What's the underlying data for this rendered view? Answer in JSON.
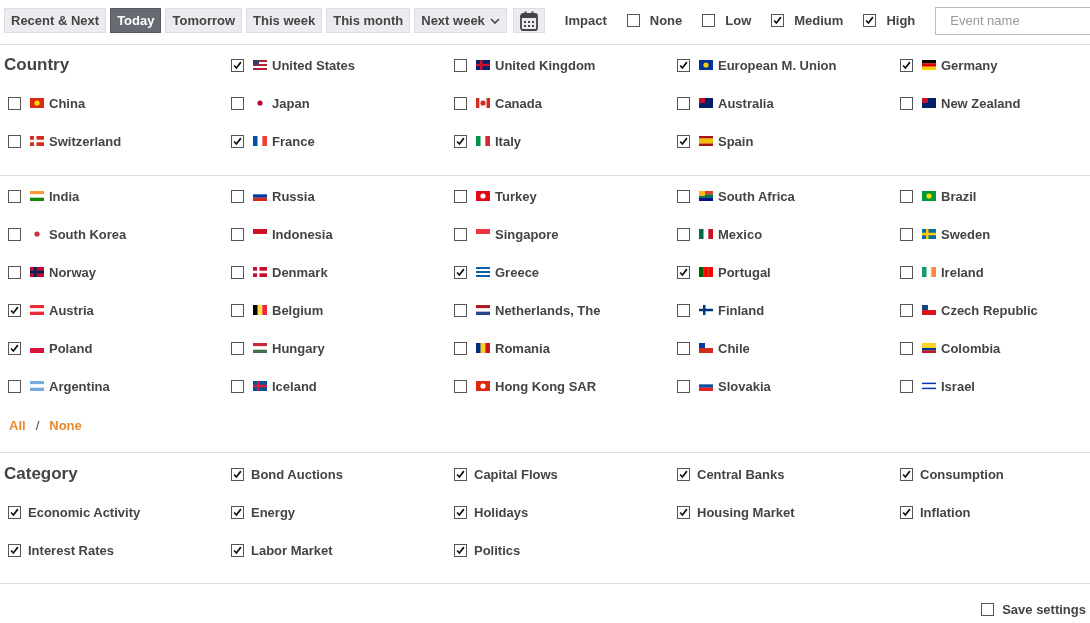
{
  "toolbar": {
    "period_tabs": [
      {
        "label": "Recent & Next",
        "selected": false,
        "kind": "plain"
      },
      {
        "label": "Today",
        "selected": true,
        "kind": "plain"
      },
      {
        "label": "Tomorrow",
        "selected": false,
        "kind": "plain"
      },
      {
        "label": "This week",
        "selected": false,
        "kind": "plain"
      },
      {
        "label": "This month",
        "selected": false,
        "kind": "plain"
      },
      {
        "label": "Next week",
        "selected": false,
        "kind": "dropdown"
      }
    ],
    "impact": {
      "label": "Impact",
      "options": [
        {
          "label": "None",
          "checked": false
        },
        {
          "label": "Low",
          "checked": false
        },
        {
          "label": "Medium",
          "checked": true
        },
        {
          "label": "High",
          "checked": true
        }
      ]
    },
    "search": {
      "placeholder": "Event name"
    }
  },
  "country": {
    "title": "Country",
    "groups": [
      [
        {
          "name": "United States",
          "checked": true
        },
        {
          "name": "United Kingdom",
          "checked": false
        },
        {
          "name": "European M. Union",
          "checked": true
        },
        {
          "name": "Germany",
          "checked": true
        },
        {
          "name": "China",
          "checked": false
        },
        {
          "name": "Japan",
          "checked": false
        },
        {
          "name": "Canada",
          "checked": false
        },
        {
          "name": "Australia",
          "checked": false
        },
        {
          "name": "New Zealand",
          "checked": false
        },
        {
          "name": "Switzerland",
          "checked": false
        },
        {
          "name": "France",
          "checked": true
        },
        {
          "name": "Italy",
          "checked": true
        },
        {
          "name": "Spain",
          "checked": true
        }
      ],
      [
        {
          "name": "India",
          "checked": false
        },
        {
          "name": "Russia",
          "checked": false
        },
        {
          "name": "Turkey",
          "checked": false
        },
        {
          "name": "South Africa",
          "checked": false
        },
        {
          "name": "Brazil",
          "checked": false
        },
        {
          "name": "South Korea",
          "checked": false
        },
        {
          "name": "Indonesia",
          "checked": false
        },
        {
          "name": "Singapore",
          "checked": false
        },
        {
          "name": "Mexico",
          "checked": false
        },
        {
          "name": "Sweden",
          "checked": false
        },
        {
          "name": "Norway",
          "checked": false
        },
        {
          "name": "Denmark",
          "checked": false
        },
        {
          "name": "Greece",
          "checked": true
        },
        {
          "name": "Portugal",
          "checked": true
        },
        {
          "name": "Ireland",
          "checked": false
        },
        {
          "name": "Austria",
          "checked": true
        },
        {
          "name": "Belgium",
          "checked": false
        },
        {
          "name": "Netherlands, The",
          "checked": false
        },
        {
          "name": "Finland",
          "checked": false
        },
        {
          "name": "Czech Republic",
          "checked": false
        },
        {
          "name": "Poland",
          "checked": true
        },
        {
          "name": "Hungary",
          "checked": false
        },
        {
          "name": "Romania",
          "checked": false
        },
        {
          "name": "Chile",
          "checked": false
        },
        {
          "name": "Colombia",
          "checked": false
        },
        {
          "name": "Argentina",
          "checked": false
        },
        {
          "name": "Iceland",
          "checked": false
        },
        {
          "name": "Hong Kong SAR",
          "checked": false
        },
        {
          "name": "Slovakia",
          "checked": false
        },
        {
          "name": "Israel",
          "checked": false
        }
      ]
    ],
    "select_all": "All",
    "separator": "/",
    "select_none": "None"
  },
  "category": {
    "title": "Category",
    "items": [
      {
        "name": "Bond Auctions",
        "checked": true
      },
      {
        "name": "Capital Flows",
        "checked": true
      },
      {
        "name": "Central Banks",
        "checked": true
      },
      {
        "name": "Consumption",
        "checked": true
      },
      {
        "name": "Economic Activity",
        "checked": true
      },
      {
        "name": "Energy",
        "checked": true
      },
      {
        "name": "Holidays",
        "checked": true
      },
      {
        "name": "Housing Market",
        "checked": true
      },
      {
        "name": "Inflation",
        "checked": true
      },
      {
        "name": "Interest Rates",
        "checked": true
      },
      {
        "name": "Labor Market",
        "checked": true
      },
      {
        "name": "Politics",
        "checked": true
      }
    ]
  },
  "save_settings": {
    "label": "Save settings",
    "checked": false
  }
}
